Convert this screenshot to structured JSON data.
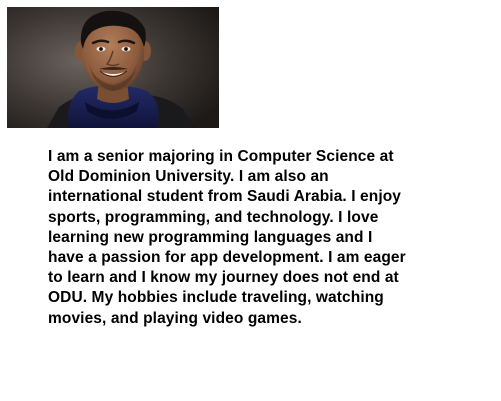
{
  "profile": {
    "photo_icon": "portrait-photo",
    "bio_lines": [
      "I am a senior majoring in Computer Science at",
      "Old Dominion University. I am also an",
      "international student from Saudi Arabia. I enjoy",
      "sports, programming, and technology. I love",
      "learning new programming languages and I",
      "have a passion for app development. I am eager",
      "to learn and I know my journey does not end at",
      "ODU. My hobbies include traveling, watching",
      "movies, and playing video games."
    ]
  },
  "colors": {
    "background": "#ffffff",
    "text": "#000000",
    "photo_backdrop": "#2a2624"
  }
}
